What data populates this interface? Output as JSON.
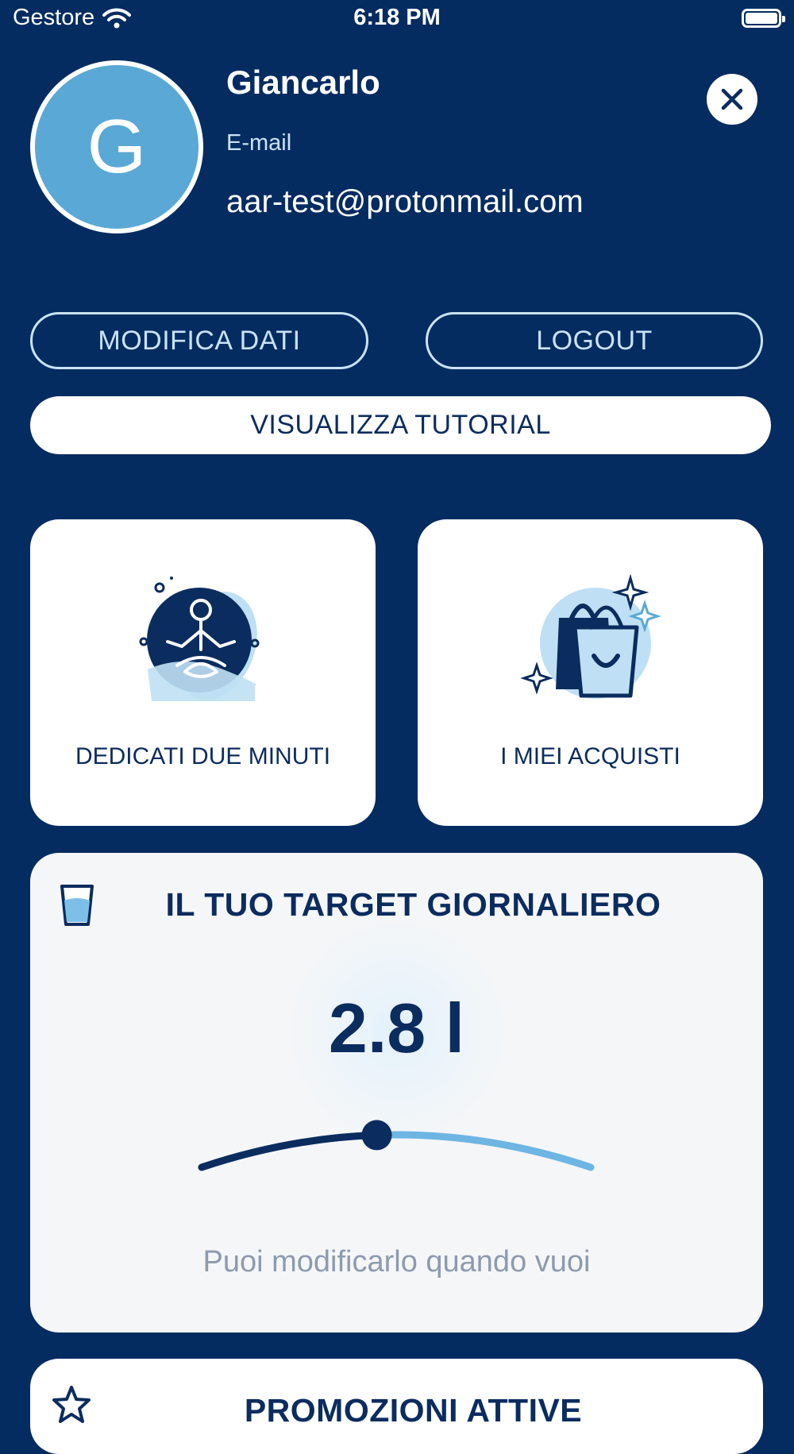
{
  "status_bar": {
    "carrier": "Gestore",
    "time": "6:18 PM",
    "wifi_icon": "wifi-icon",
    "battery_icon": "battery-icon"
  },
  "profile": {
    "avatar_initial": "G",
    "name": "Giancarlo",
    "email_label": "E-mail",
    "email": "aar-test@protonmail.com",
    "close_icon": "close-icon"
  },
  "actions": {
    "edit_label": "MODIFICA DATI",
    "logout_label": "LOGOUT",
    "tutorial_label": "VISUALIZZA TUTORIAL"
  },
  "cards": [
    {
      "label": "DEDICATI DUE MINUTI",
      "icon": "meditation-icon"
    },
    {
      "label": "I MIEI ACQUISTI",
      "icon": "shopping-bag-icon"
    }
  ],
  "target": {
    "icon": "water-glass-icon",
    "title": "IL TUO TARGET GIORNALIERO",
    "value": "2.8 l",
    "hint": "Puoi modificarlo quando vuoi",
    "slider_fraction": 0.45
  },
  "promotions": {
    "icon": "star-icon",
    "title": "PROMOZIONI ATTIVE"
  },
  "colors": {
    "background": "#052c61",
    "accent_light": "#5aa8d6",
    "text_dark": "#0b2c5e",
    "hint_gray": "#8d9bae"
  }
}
